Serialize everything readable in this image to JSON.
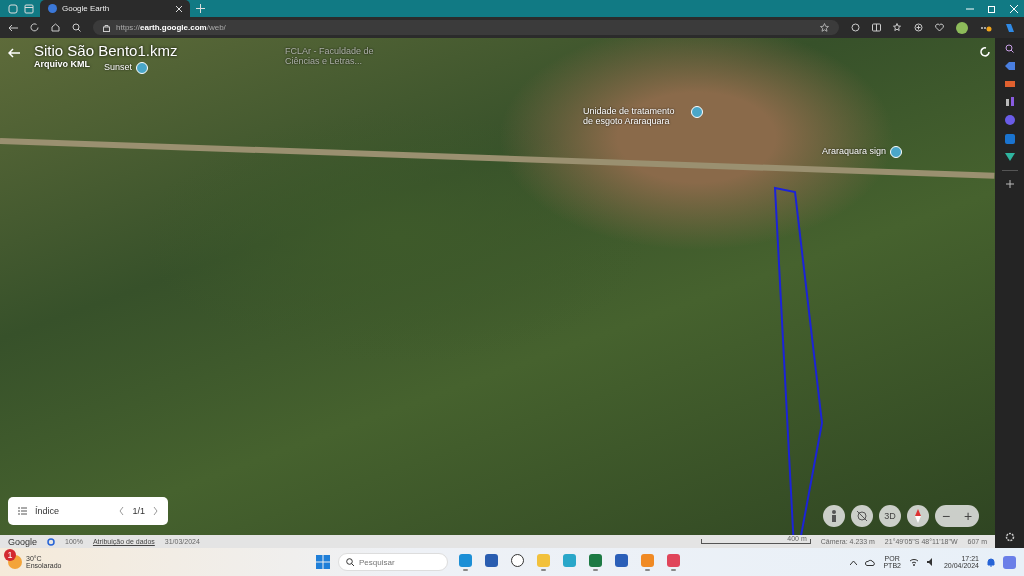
{
  "browser": {
    "tabs": [
      {
        "title": "Google Earth",
        "selected": true
      }
    ],
    "url": "https://**earth.google.com**/web/"
  },
  "earth": {
    "title": "Sitio São Bento1.kmz",
    "subtitle": "Arquivo KML",
    "map_labels": [
      {
        "text": "Sunset",
        "kind": "pin"
      },
      {
        "text": "FCLAr - Faculdade de Ciências e Letras...",
        "kind": "faded"
      },
      {
        "text": "Unidade de tratamento de esgoto Araraquara",
        "kind": "pin"
      },
      {
        "text": "Araraquara sign",
        "kind": "pin"
      }
    ],
    "index_panel": {
      "label": "Índice",
      "page": "1/1"
    },
    "controls": {
      "view_3d": "3D",
      "zoom_out": "−",
      "zoom_in": "+"
    },
    "status_bar": {
      "brand": "Google",
      "loaded": "100%",
      "attribution": "Atribuição de dados",
      "date": "31/03/2024",
      "scale": "400 m",
      "camera": "Câmera: 4.233 m",
      "coordinates": "21°49'05\"S 48°11'18\"W",
      "elevation": "607 m"
    }
  },
  "taskbar": {
    "weather": {
      "badge": "1",
      "temperature": "30°C",
      "condition": "Ensolarado"
    },
    "search_placeholder": "Pesquisar",
    "apps": [
      {
        "kind": "edge",
        "running": true
      },
      {
        "kind": "store",
        "running": false
      },
      {
        "kind": "dell",
        "running": false
      },
      {
        "kind": "folder",
        "running": true
      },
      {
        "kind": "app",
        "running": false
      },
      {
        "kind": "excel",
        "running": true
      },
      {
        "kind": "word",
        "running": false
      },
      {
        "kind": "media",
        "running": true
      },
      {
        "kind": "snip",
        "running": true
      }
    ],
    "language": "POR",
    "layout": "PTB2",
    "time": "17:21",
    "date": "20/04/2024"
  }
}
